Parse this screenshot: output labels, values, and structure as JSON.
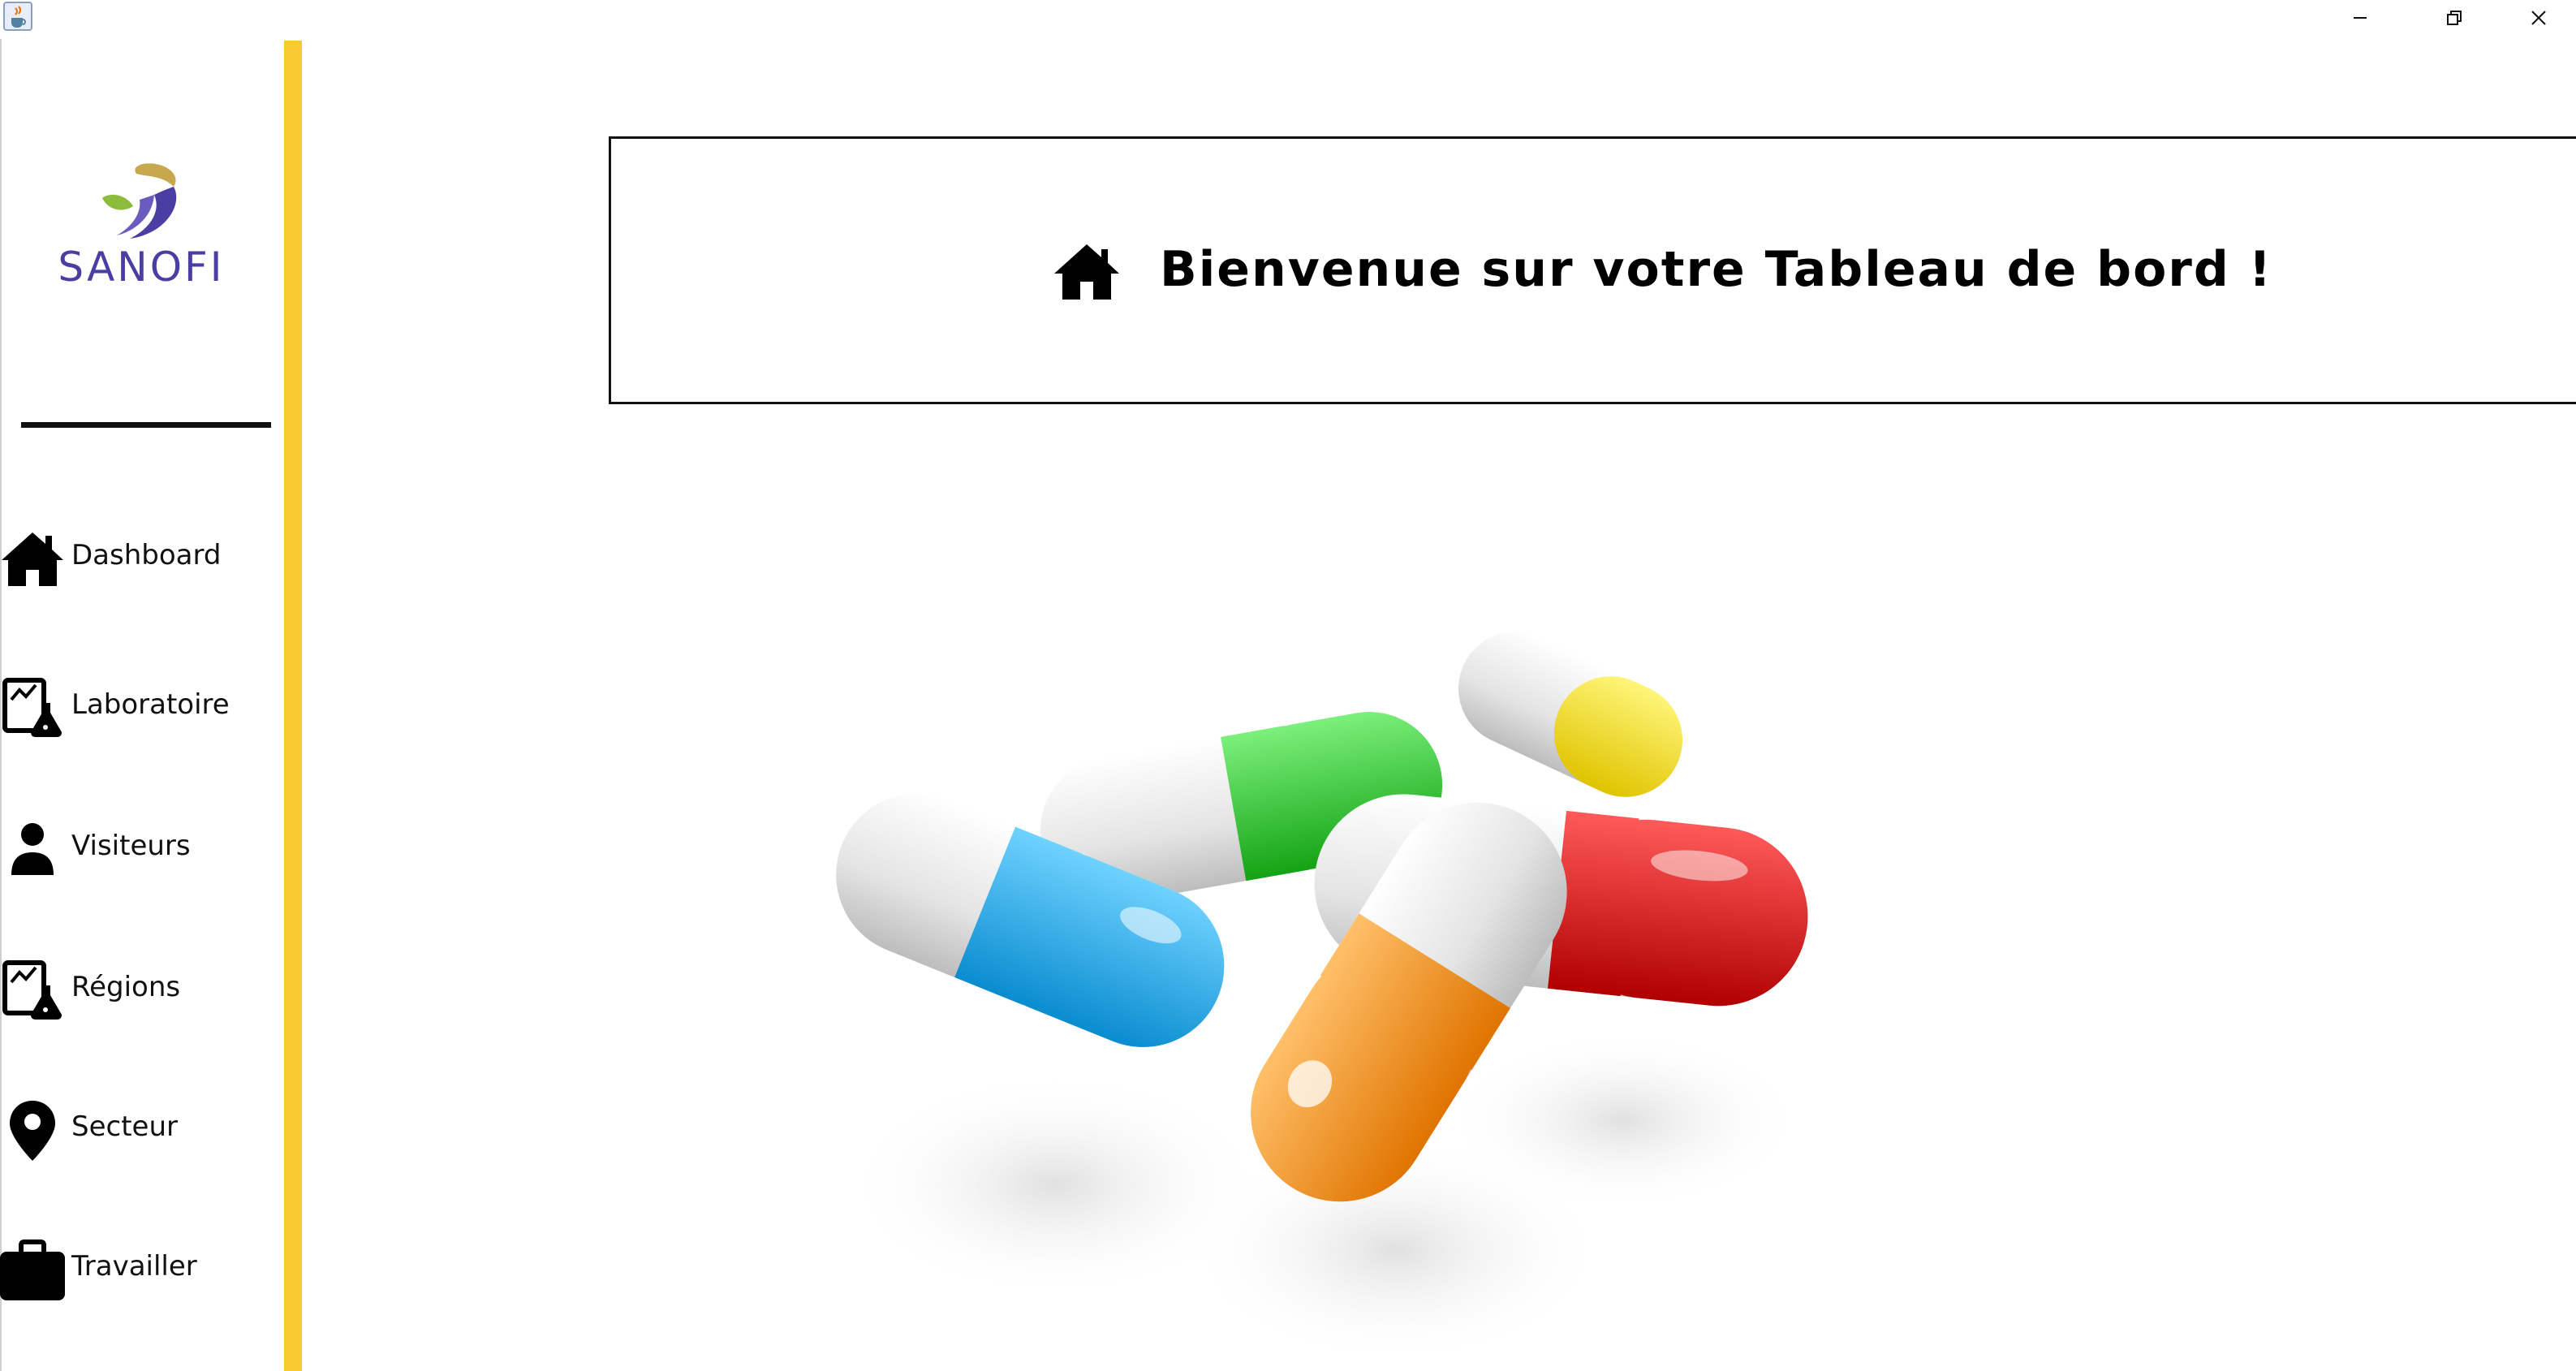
{
  "window": {
    "app_icon": "java-cup-icon",
    "controls": [
      "minimize-icon",
      "restore-icon",
      "close-icon"
    ]
  },
  "sidebar": {
    "logo_text": "SANOFI",
    "accent_color": "#f8c931",
    "items": [
      {
        "label": "Dashboard",
        "icon": "home-icon"
      },
      {
        "label": "Laboratoire",
        "icon": "lab-report-icon"
      },
      {
        "label": "Visiteurs",
        "icon": "user-icon"
      },
      {
        "label": "Régions",
        "icon": "lab-report-icon"
      },
      {
        "label": "Secteur",
        "icon": "map-pin-icon"
      },
      {
        "label": "Travailler",
        "icon": "briefcase-icon"
      }
    ]
  },
  "header": {
    "title": "Bienvenue sur votre Tableau de bord !",
    "icon": "home-icon"
  },
  "main": {
    "illustration": "capsule-pills-image",
    "pill_colors": [
      "#29a9e6",
      "#2ecc2e",
      "#f4e01a",
      "#e01818",
      "#f4921e"
    ]
  }
}
